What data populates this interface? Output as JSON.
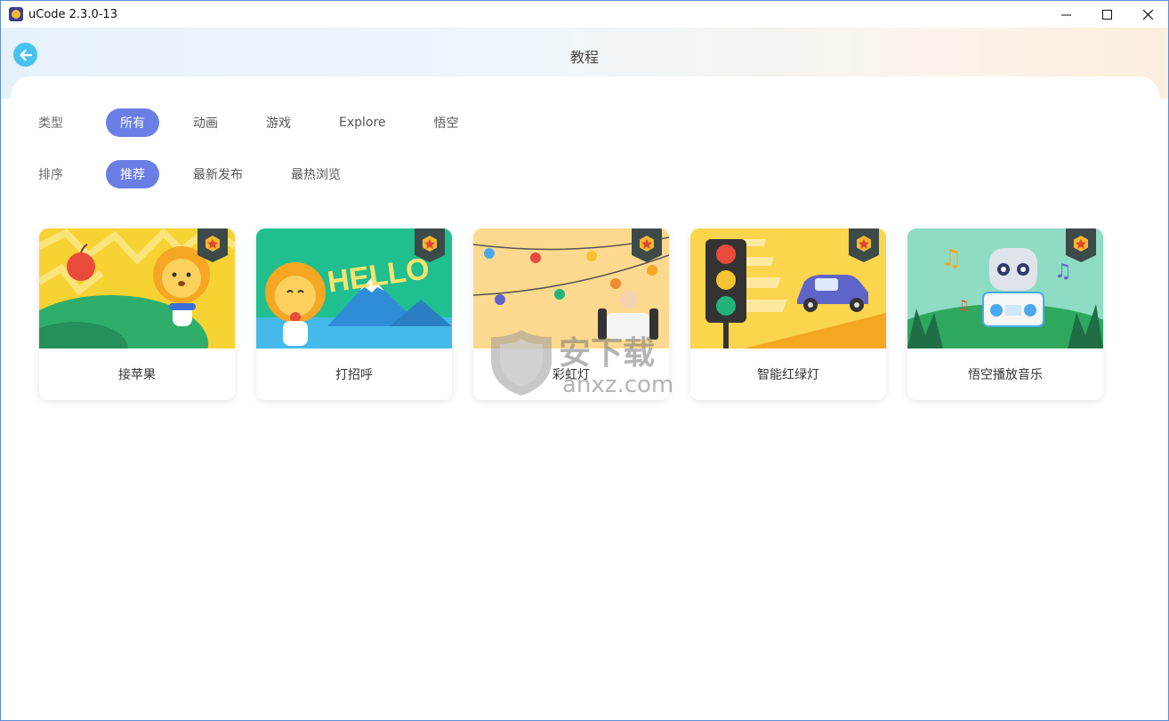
{
  "window": {
    "title": "uCode 2.3.0-13",
    "minimize": "—",
    "maximize": "☐",
    "close": "✕"
  },
  "header": {
    "title": "教程"
  },
  "filters": {
    "type_label": "类型",
    "types": [
      "所有",
      "动画",
      "游戏",
      "Explore",
      "悟空"
    ],
    "type_selected": "所有",
    "sort_label": "排序",
    "sorts": [
      "推荐",
      "最新发布",
      "最热浏览"
    ],
    "sort_selected": "推荐"
  },
  "cards": [
    {
      "title": "接苹果",
      "bg": "#f7d233"
    },
    {
      "title": "打招呼",
      "bg": "#1fbf8f"
    },
    {
      "title": "彩虹灯",
      "bg": "#fcd98e"
    },
    {
      "title": "智能红绿灯",
      "bg": "#fbd54c"
    },
    {
      "title": "悟空播放音乐",
      "bg": "#8fdcc4"
    }
  ],
  "watermark": {
    "text": "安下载",
    "sub": "anxz.com"
  },
  "colors": {
    "accent": "#6a7ee6",
    "back_button": "#45c2ef",
    "badge": "#f5b82e"
  }
}
